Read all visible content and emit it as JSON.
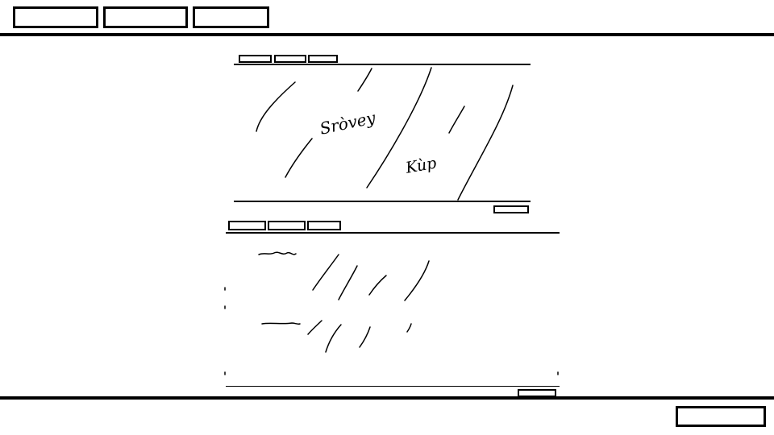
{
  "colors": {
    "ink": "#000000",
    "paper": "#ffffff"
  },
  "top_tabs": [
    "",
    "",
    ""
  ],
  "panel1": {
    "tabs": [
      "",
      "",
      ""
    ],
    "handwriting": [
      "Sròvey",
      "Kùp"
    ],
    "button_label": ""
  },
  "panel2": {
    "tabs": [
      "",
      "",
      ""
    ],
    "button_label": ""
  },
  "footer": {
    "button_label": ""
  }
}
